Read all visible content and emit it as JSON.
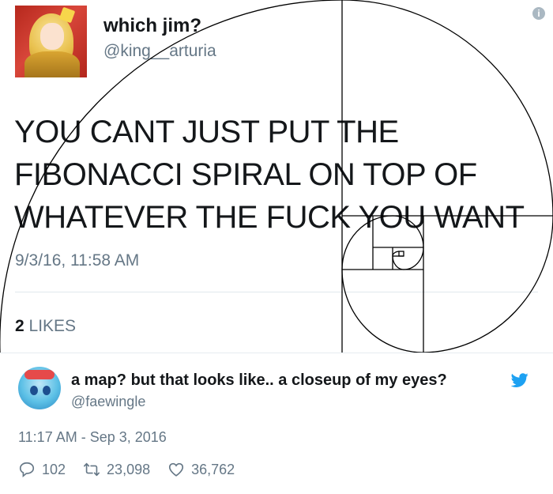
{
  "tweet1": {
    "display_name": "which jim?",
    "handle": "@king__arturia",
    "text": "YOU CANT JUST PUT THE FIBONACCI SPIRAL ON TOP OF WHATEVER THE FUCK YOU WANT",
    "timestamp": "9/3/16, 11:58 AM",
    "likes_count": "2",
    "likes_label": "LIKES"
  },
  "tweet2": {
    "display_name": "a map? but that looks like.. a closeup of my eyes?",
    "handle": "@faewingle",
    "timestamp": "11:17 AM - Sep 3, 2016",
    "replies": "102",
    "retweets": "23,098",
    "likes": "36,762"
  },
  "colors": {
    "text": "#14171a",
    "muted": "#657786",
    "twitter_blue": "#1da1f2",
    "divider": "#e1e8ed"
  },
  "icons": [
    "info-icon",
    "twitter-bird-icon",
    "reply-icon",
    "retweet-icon",
    "heart-icon"
  ]
}
